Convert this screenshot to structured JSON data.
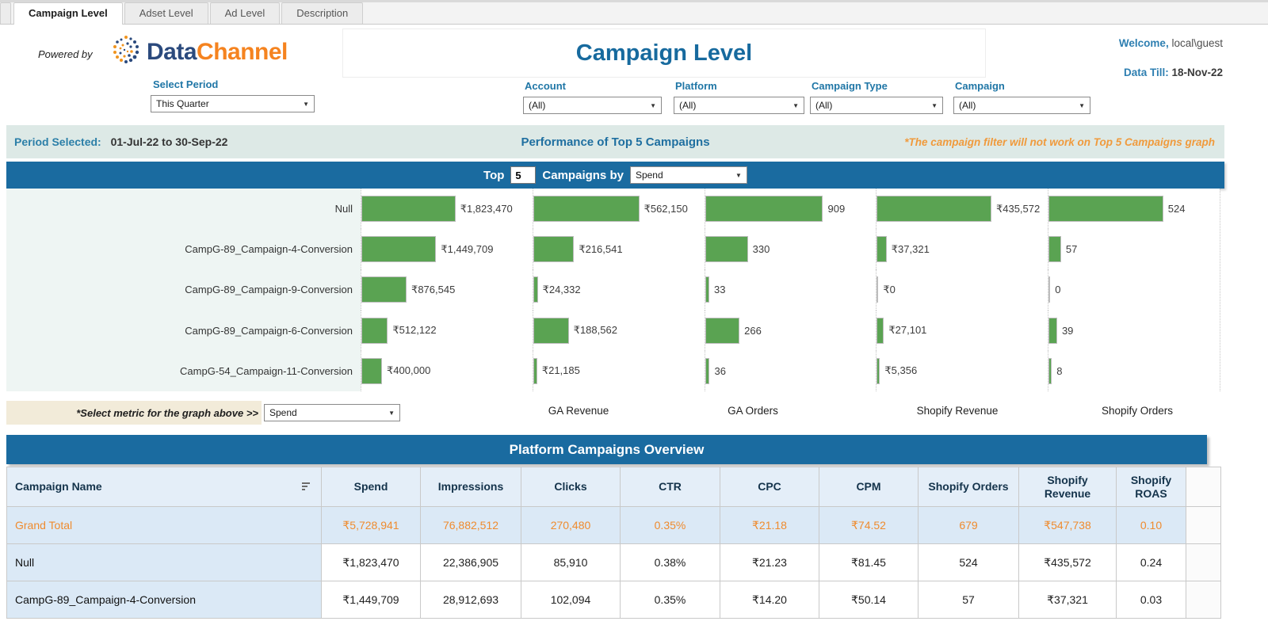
{
  "tabs": [
    {
      "label": "Campaign Level",
      "active": true
    },
    {
      "label": "Adset Level",
      "active": false
    },
    {
      "label": "Ad Level",
      "active": false
    },
    {
      "label": "Description",
      "active": false
    }
  ],
  "header": {
    "powered_by": "Powered by",
    "brand_data": "Data",
    "brand_channel": "Channel",
    "title": "Campaign Level",
    "welcome_label": "Welcome,",
    "welcome_user": " local\\guest",
    "data_till_label": "Data Till:",
    "data_till_value": " 18-Nov-22"
  },
  "filters": {
    "period": {
      "label": "Select Period",
      "value": "This Quarter"
    },
    "account": {
      "label": "Account",
      "value": "(All)"
    },
    "platform": {
      "label": "Platform",
      "value": "(All)"
    },
    "campaign_type": {
      "label": "Campaign Type",
      "value": "(All)"
    },
    "campaign": {
      "label": "Campaign",
      "value": "(All)"
    }
  },
  "period_bar": {
    "label": "Period Selected:",
    "value": "01-Jul-22 to 30-Sep-22",
    "center_title": "Performance of Top 5 Campaigns",
    "note": "*The campaign filter will not work on Top 5 Campaigns graph"
  },
  "top_controls": {
    "top_label": "Top",
    "top_n": "5",
    "by_label": "Campaigns by",
    "metric": "Spend"
  },
  "chart_data": {
    "type": "bar",
    "orientation": "horizontal",
    "bar_color": "#5aa352",
    "categories": [
      "Null",
      "CampG-89_Campaign-4-Conversion",
      "CampG-89_Campaign-9-Conversion",
      "CampG-89_Campaign-6-Conversion",
      "CampG-54_Campaign-11-Conversion"
    ],
    "series": [
      {
        "name": "Spend",
        "values": [
          1823470,
          1449709,
          876545,
          512122,
          400000
        ],
        "labels": [
          "₹1,823,470",
          "₹1,449,709",
          "₹876,545",
          "₹512,122",
          "₹400,000"
        ]
      },
      {
        "name": "GA Revenue",
        "values": [
          562150,
          216541,
          24332,
          188562,
          21185
        ],
        "labels": [
          "₹562,150",
          "₹216,541",
          "₹24,332",
          "₹188,562",
          "₹21,185"
        ]
      },
      {
        "name": "GA Orders",
        "values": [
          909,
          330,
          33,
          266,
          36
        ],
        "labels": [
          "909",
          "330",
          "33",
          "266",
          "36"
        ]
      },
      {
        "name": "Shopify Revenue",
        "values": [
          435572,
          37321,
          0,
          27101,
          5356
        ],
        "labels": [
          "₹435,572",
          "₹37,321",
          "₹0",
          "₹27,101",
          "₹5,356"
        ]
      },
      {
        "name": "Shopify Orders",
        "values": [
          524,
          57,
          0,
          39,
          8
        ],
        "labels": [
          "524",
          "57",
          "0",
          "39",
          "8"
        ]
      }
    ]
  },
  "metric_row": {
    "prompt": "*Select metric for the graph above >>",
    "dropdown_value": "Spend",
    "axis_labels": [
      "GA Revenue",
      "GA Orders",
      "Shopify Revenue",
      "Shopify Orders"
    ]
  },
  "table": {
    "banner": "Platform Campaigns Overview",
    "columns": [
      "Campaign Name",
      "Spend",
      "Impressions",
      "Clicks",
      "CTR",
      "CPC",
      "CPM",
      "Shopify Orders",
      "Shopify Revenue",
      "Shopify ROAS"
    ],
    "rows": [
      {
        "name": "Grand Total",
        "highlight": true,
        "values": [
          "₹5,728,941",
          "76,882,512",
          "270,480",
          "0.35%",
          "₹21.18",
          "₹74.52",
          "679",
          "₹547,738",
          "0.10"
        ]
      },
      {
        "name": "Null",
        "highlight": false,
        "values": [
          "₹1,823,470",
          "22,386,905",
          "85,910",
          "0.38%",
          "₹21.23",
          "₹81.45",
          "524",
          "₹435,572",
          "0.24"
        ]
      },
      {
        "name": "CampG-89_Campaign-4-Conversion",
        "highlight": false,
        "values": [
          "₹1,449,709",
          "28,912,693",
          "102,094",
          "0.35%",
          "₹14.20",
          "₹50.14",
          "57",
          "₹37,321",
          "0.03"
        ]
      }
    ]
  },
  "colors": {
    "banner_blue": "#1a6ba0",
    "title_blue": "#176a9e",
    "bar_green": "#5aa352",
    "accent_orange": "#ef8b2e",
    "row_blue": "#dbe9f6"
  }
}
